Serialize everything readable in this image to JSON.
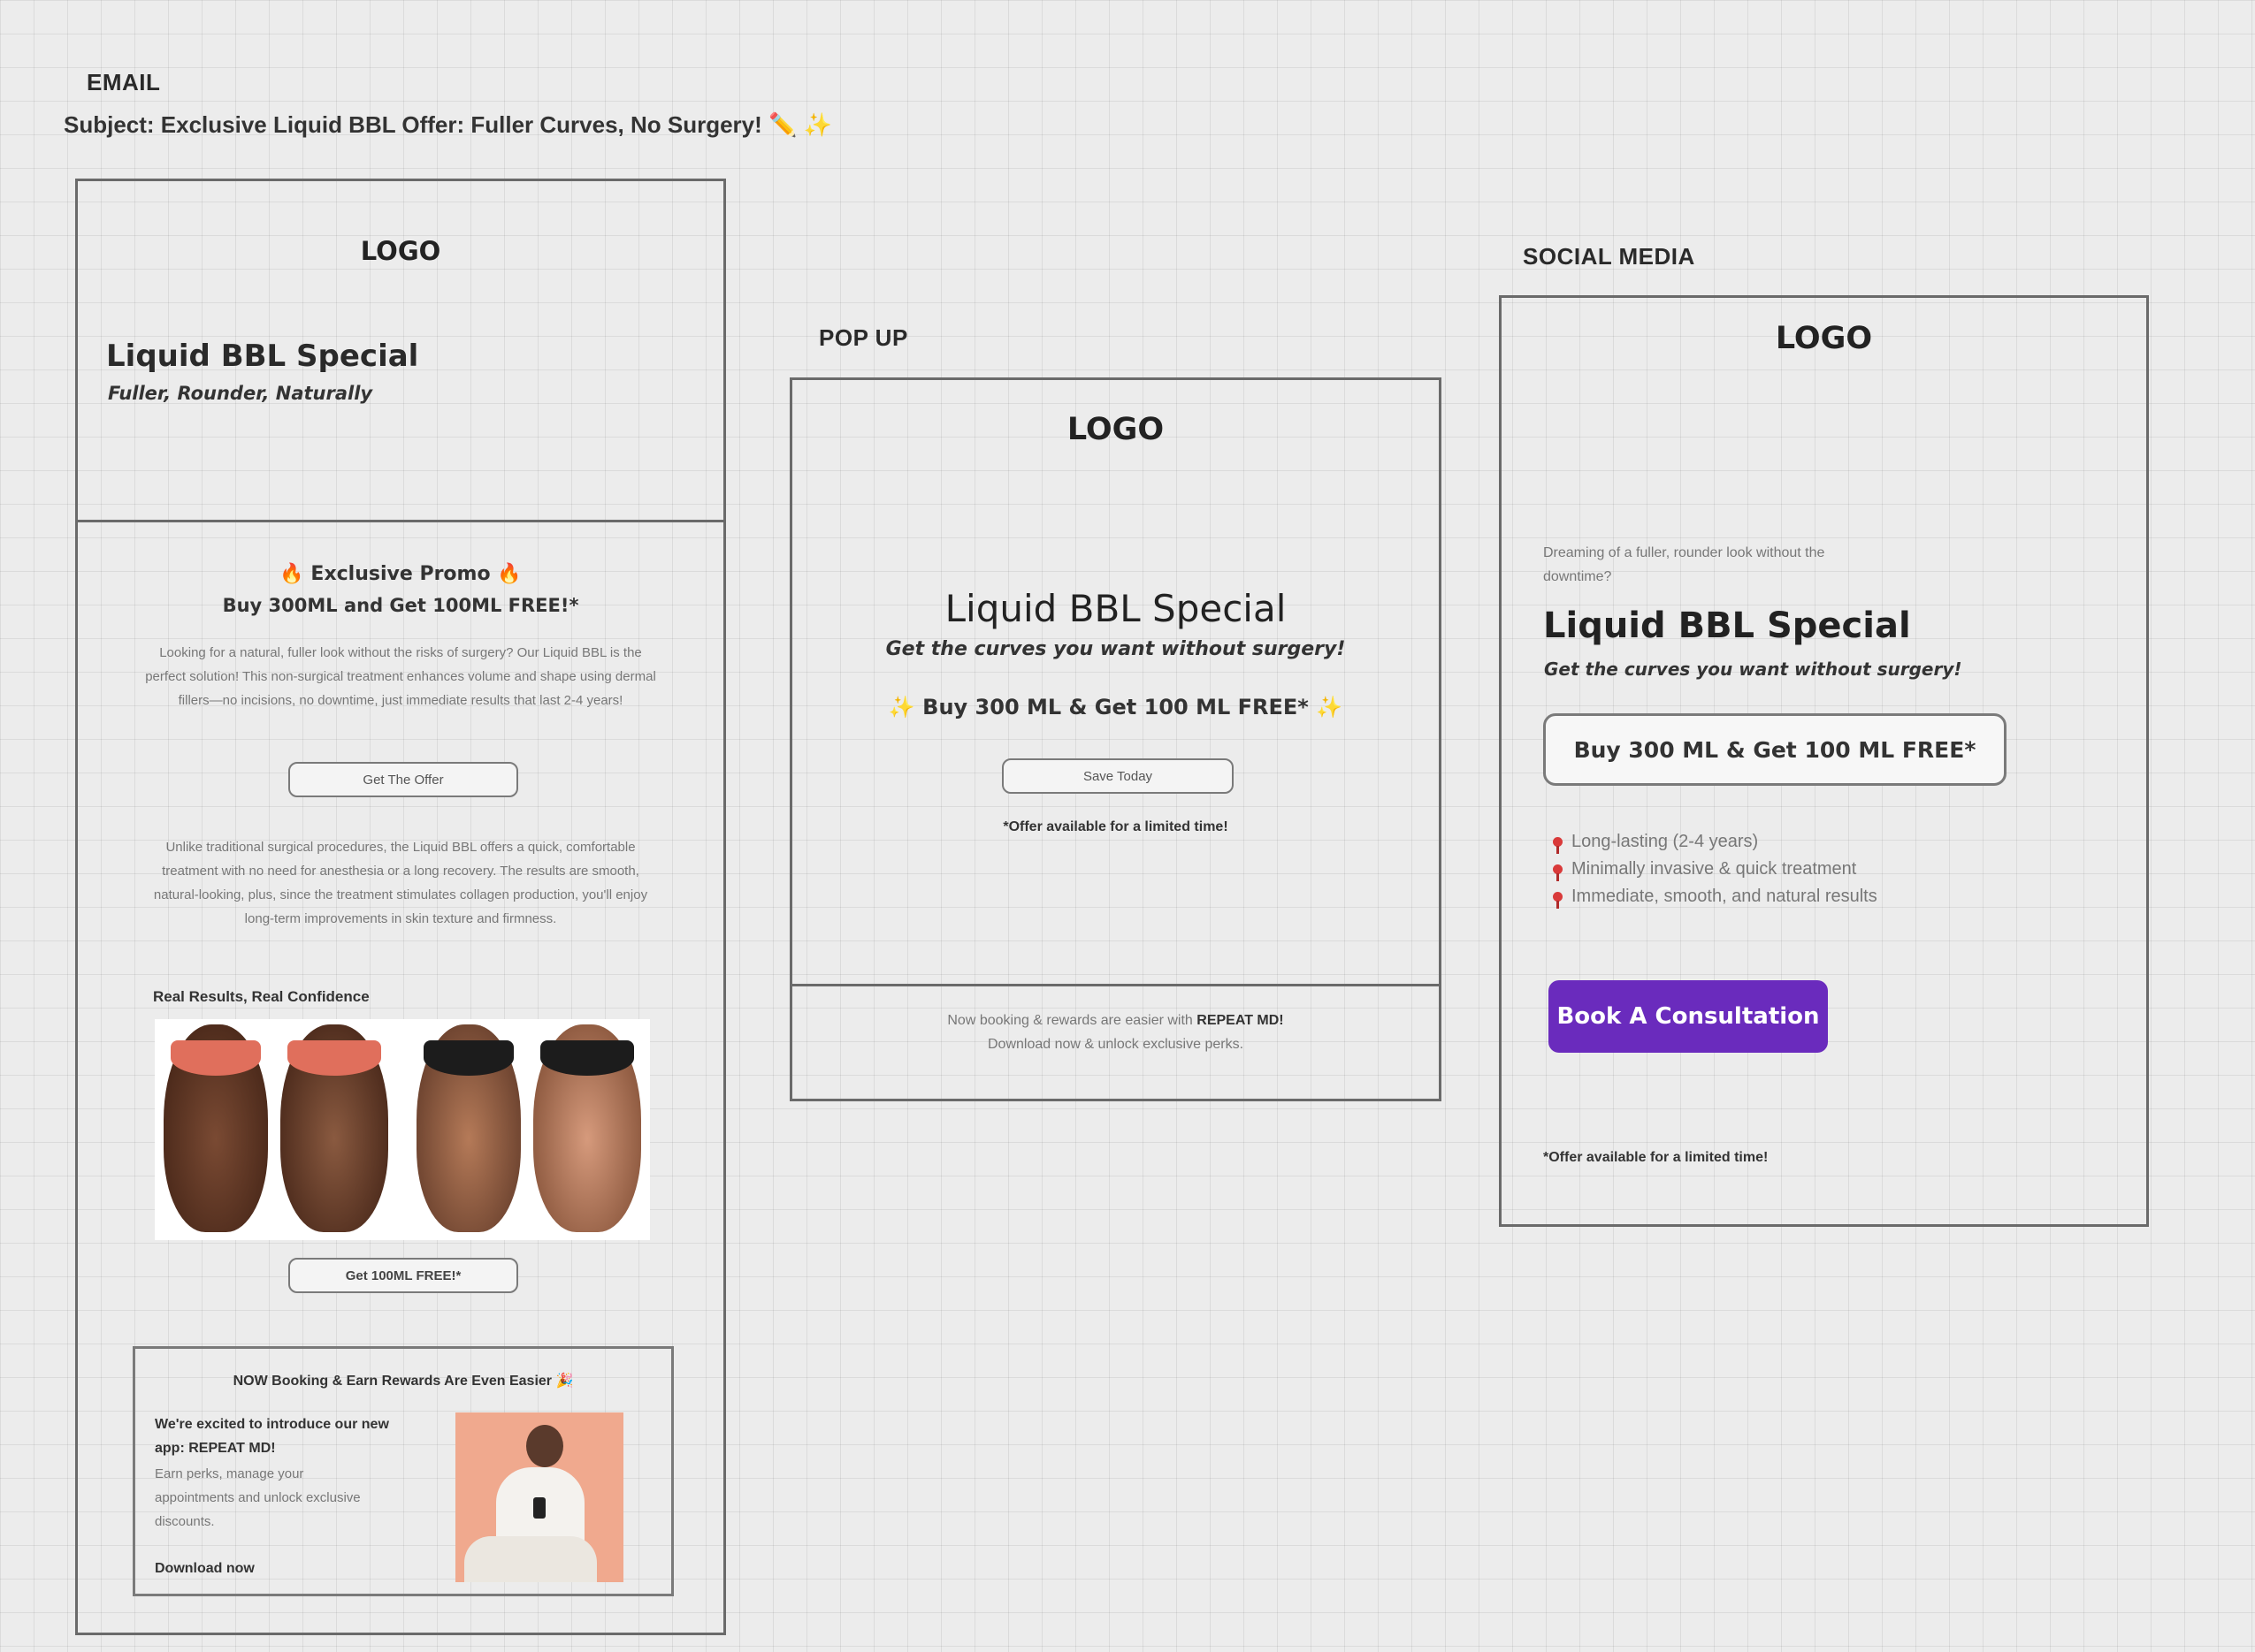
{
  "email": {
    "section_label": "EMAIL",
    "subject": "Subject: Exclusive Liquid BBL Offer: Fuller Curves, No Surgery! ✏️ ✨",
    "logo": "LOGO",
    "title": "Liquid BBL Special",
    "tagline": "Fuller, Rounder, Naturally",
    "promo_heading": "🔥 Exclusive Promo 🔥",
    "promo_offer": "Buy 300ML and Get 100ML FREE!*",
    "paragraph1": "Looking for a natural, fuller look without the risks of surgery? Our Liquid BBL is the perfect solution! This non-surgical treatment enhances volume and shape using dermal fillers—no incisions, no downtime, just immediate results that last 2-4 years!",
    "cta1": "Get The Offer",
    "paragraph2": "Unlike traditional surgical procedures, the Liquid BBL offers a quick, comfortable treatment with no need for anesthesia or a long recovery. The results are smooth, natural-looking, plus, since the treatment stimulates collagen production, you'll enjoy long-term improvements in skin texture and firmness.",
    "results_heading": "Real Results, Real Confidence",
    "cta2": "Get 100ML FREE!*",
    "rewards": {
      "heading": "NOW Booking & Earn Rewards Are Even Easier 🎉",
      "intro": "We're excited to introduce our new app: REPEAT MD!",
      "body": "Earn perks, manage your appointments and unlock exclusive discounts.",
      "download": "Download now"
    }
  },
  "popup": {
    "section_label": "POP UP",
    "logo": "LOGO",
    "title": "Liquid BBL Special",
    "tagline": "Get the curves you want without surgery!",
    "offer": "✨ Buy 300 ML & Get 100 ML FREE* ✨",
    "cta": "Save Today",
    "disclaimer": "*Offer available for a limited time!",
    "footer_line1_prefix": "Now booking & rewards are easier with ",
    "footer_line1_brand": "REPEAT MD!",
    "footer_line2": "Download now & unlock exclusive perks."
  },
  "social": {
    "section_label": "SOCIAL MEDIA",
    "logo": "LOGO",
    "intro": "Dreaming of a fuller, rounder look without the downtime?",
    "title": "Liquid BBL Special",
    "tagline": "Get the curves you want without surgery!",
    "offer": "Buy 300 ML & Get 100 ML FREE*",
    "bullets": [
      "Long-lasting (2-4 years)",
      "Minimally invasive & quick treatment",
      "Immediate, smooth, and natural results"
    ],
    "bullet_icon": "pin-icon",
    "cta": "Book A Consultation",
    "cta_color": "#6a2bbd",
    "disclaimer": "*Offer available for a limited time!"
  }
}
